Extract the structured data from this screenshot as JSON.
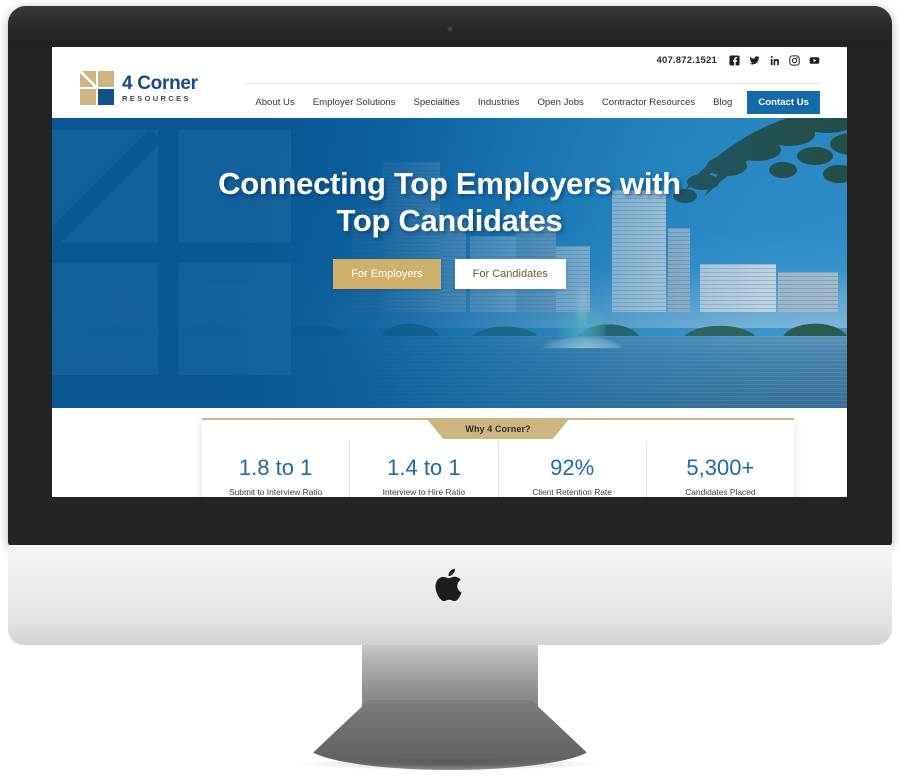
{
  "device": {
    "brand_logo": "apple-logo",
    "type": "imac-desktop-monitor"
  },
  "site": {
    "utility_bar": {
      "phone": "407.872.1521",
      "social_links": [
        {
          "name": "facebook-icon",
          "label": "Facebook"
        },
        {
          "name": "twitter-icon",
          "label": "Twitter"
        },
        {
          "name": "linkedin-icon",
          "label": "LinkedIn"
        },
        {
          "name": "instagram-icon",
          "label": "Instagram"
        },
        {
          "name": "youtube-icon",
          "label": "YouTube"
        }
      ]
    },
    "brand": {
      "name_line1": "4 Corner",
      "name_line2": "RESOURCES",
      "logo_colors": {
        "tan": "#cdb582",
        "blue": "#11528c"
      }
    },
    "nav": {
      "items": [
        {
          "label": "About Us"
        },
        {
          "label": "Employer Solutions"
        },
        {
          "label": "Specialties"
        },
        {
          "label": "Industries"
        },
        {
          "label": "Open Jobs"
        },
        {
          "label": "Contractor Resources"
        },
        {
          "label": "Blog"
        }
      ],
      "cta": {
        "label": "Contact Us",
        "color": "#136aa8"
      }
    },
    "hero": {
      "title_line1": "Connecting Top Employers with",
      "title_line2": "Top Candidates",
      "buttons": [
        {
          "label": "For Employers",
          "style": "gold",
          "color": "#cdb069"
        },
        {
          "label": "For Candidates",
          "style": "white",
          "color": "#ffffff"
        }
      ],
      "background_description": "Orlando Lake Eola skyline with fountain",
      "overlay_color": "#085692"
    },
    "stats": {
      "tab_label": "Why 4 Corner?",
      "accent_color": "#cdb582",
      "number_color": "#1d6aa5",
      "items": [
        {
          "value": "1.8 to 1",
          "label": "Submit to Interview Ratio"
        },
        {
          "value": "1.4 to 1",
          "label": "Interview to Hire Ratio"
        },
        {
          "value": "92%",
          "label": "Client Retention Rate"
        },
        {
          "value": "5,300+",
          "label": "Candidates Placed"
        }
      ]
    }
  }
}
